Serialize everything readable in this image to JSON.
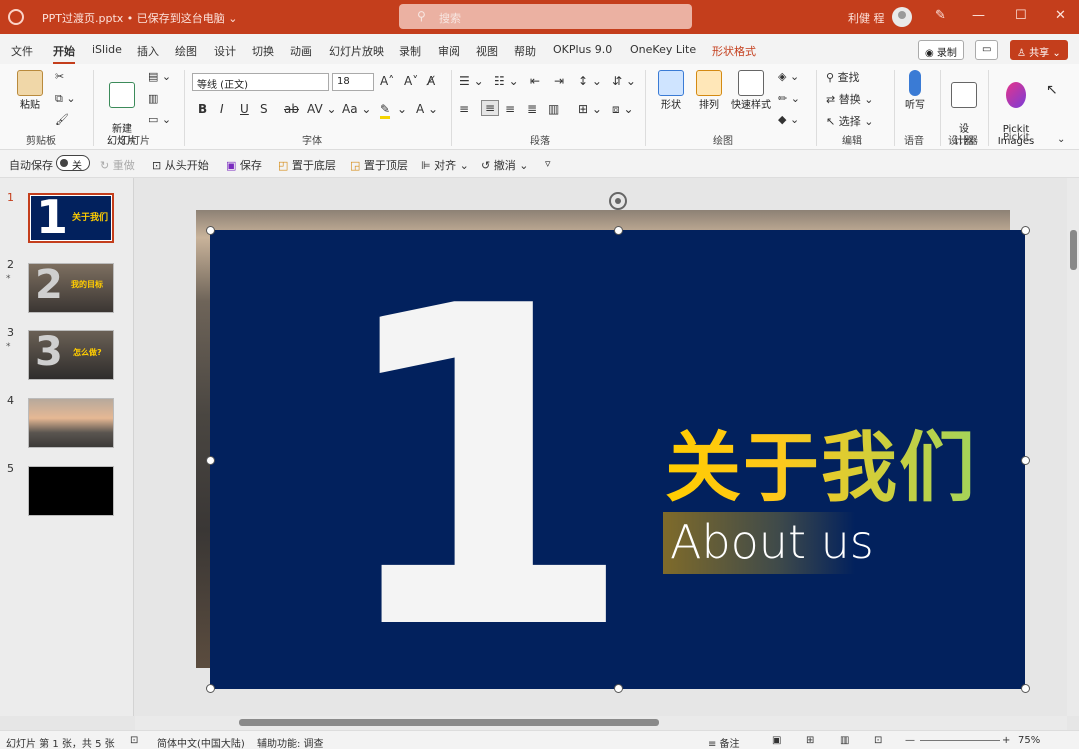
{
  "titlebar": {
    "doc_title": "PPT过渡页.pptx • 已保存到这台电脑 ⌄",
    "search_placeholder": "搜索",
    "user": "利健 程",
    "minimize": "—",
    "maximize": "☐",
    "close": "✕"
  },
  "tabs": [
    "文件",
    "开始",
    "iSlide",
    "插入",
    "绘图",
    "设计",
    "切换",
    "动画",
    "幻灯片放映",
    "录制",
    "审阅",
    "视图",
    "帮助",
    "OKPlus 9.0",
    "OneKey Lite",
    "形状格式"
  ],
  "top_buttons": {
    "record": "◉ 录制",
    "comment": "▭",
    "share": "♙ 共享 ⌄"
  },
  "ribbon": {
    "clipboard": {
      "paste": "粘贴",
      "label": "剪贴板"
    },
    "slides": {
      "new_slide": "新建\n幻灯片",
      "label": "幻灯片"
    },
    "font": {
      "name": "等线 (正文)",
      "size": "18",
      "label": "字体"
    },
    "paragraph": {
      "label": "段落"
    },
    "drawing": {
      "shape": "形状",
      "arrange": "排列",
      "quick_styles": "快速样式",
      "label": "绘图"
    },
    "editing": {
      "find": "查找",
      "replace": "替换",
      "select": "选择",
      "label": "编辑"
    },
    "voice": {
      "dictate": "听写",
      "label": "语音"
    },
    "designer": {
      "design": "设\n计器",
      "label": "设计器"
    },
    "pickit": {
      "images": "Pickit\nImages",
      "label": "Pickit"
    }
  },
  "qat": {
    "autosave": "自动保存",
    "toggle": "关",
    "redo": "重做",
    "from_start": "从头开始",
    "save": "保存",
    "send_back": "置于底层",
    "bring_front": "置于顶层",
    "align": "对齐",
    "undo": "撤消"
  },
  "thumbnails": [
    {
      "num": "1",
      "star": "",
      "title": "关于我们"
    },
    {
      "num": "2",
      "star": "*",
      "title": "我的目标"
    },
    {
      "num": "3",
      "star": "*",
      "title": "怎么做?"
    },
    {
      "num": "4",
      "star": "",
      "title": ""
    },
    {
      "num": "5",
      "star": "",
      "title": ""
    }
  ],
  "slide": {
    "number": "1",
    "title_cn": "关于我们",
    "title_en": "About us"
  },
  "status": {
    "slide_info": "幻灯片 第 1 张，共 5 张",
    "language": "简体中文(中国大陆)",
    "accessibility": "辅助功能: 调查",
    "notes": "≡ 备注",
    "zoom": "75%"
  },
  "colors": {
    "accent": "#c43e1c",
    "slide_bg": "#02215d",
    "title_yellow": "#ffcc00",
    "title_green": "#a3d45a"
  }
}
